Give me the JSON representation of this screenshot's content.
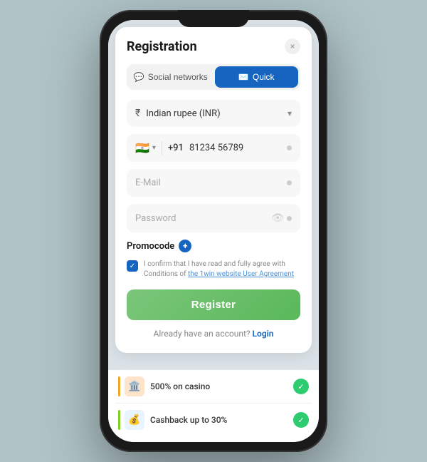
{
  "phone": {
    "notch": true
  },
  "modal": {
    "title": "Registration",
    "close_label": "×",
    "tabs": [
      {
        "id": "social",
        "label": "Social networks",
        "icon": "💬",
        "active": false
      },
      {
        "id": "quick",
        "label": "Quick",
        "icon": "✉️",
        "active": true
      }
    ],
    "currency": {
      "icon": "₹",
      "value": "Indian rupee (INR)"
    },
    "phone_field": {
      "flag": "🇮🇳",
      "prefix": "+91",
      "value": "81234 56789"
    },
    "email_placeholder": "E-Mail",
    "password_placeholder": "Password",
    "promocode_label": "Promocode",
    "agreement_text": "I confirm that I have read and fully agree with Conditions of the 1win website User Agreement",
    "register_label": "Register",
    "login_prompt": "Already have an account?",
    "login_label": "Login"
  },
  "promos": [
    {
      "icon": "🏛️",
      "text": "500% on casino",
      "accent_color": "#f5a623"
    },
    {
      "icon": "💰",
      "text": "Cashback up to 30%",
      "accent_color": "#7ed321"
    }
  ]
}
